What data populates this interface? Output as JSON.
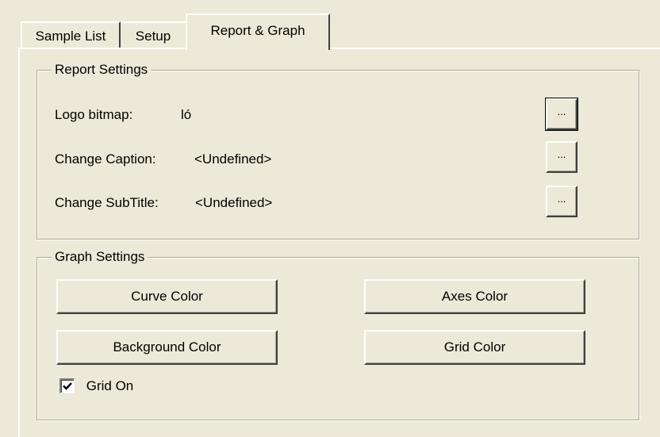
{
  "tabs": [
    {
      "label": "Sample List",
      "active": false
    },
    {
      "label": "Setup",
      "active": false
    },
    {
      "label": "Report & Graph",
      "active": true
    }
  ],
  "report_settings": {
    "title": "Report Settings",
    "logo": {
      "label": "Logo bitmap:",
      "value": "ló",
      "button": "..."
    },
    "caption": {
      "label": "Change Caption:",
      "value": "<Undefined>",
      "button": "..."
    },
    "subtitle": {
      "label": "Change SubTitle:",
      "value": "<Undefined>",
      "button": "..."
    }
  },
  "graph_settings": {
    "title": "Graph Settings",
    "curve_color": "Curve Color",
    "axes_color": "Axes Color",
    "background_color": "Background Color",
    "grid_color": "Grid Color",
    "grid_on": {
      "label": "Grid On",
      "checked": true
    }
  },
  "colors": {
    "window": "#ece9d8",
    "frame_dark": "#404040",
    "frame_light": "#ffffff",
    "group_border": "#aca899"
  },
  "icons": {
    "checkbox_check": "check-icon"
  }
}
